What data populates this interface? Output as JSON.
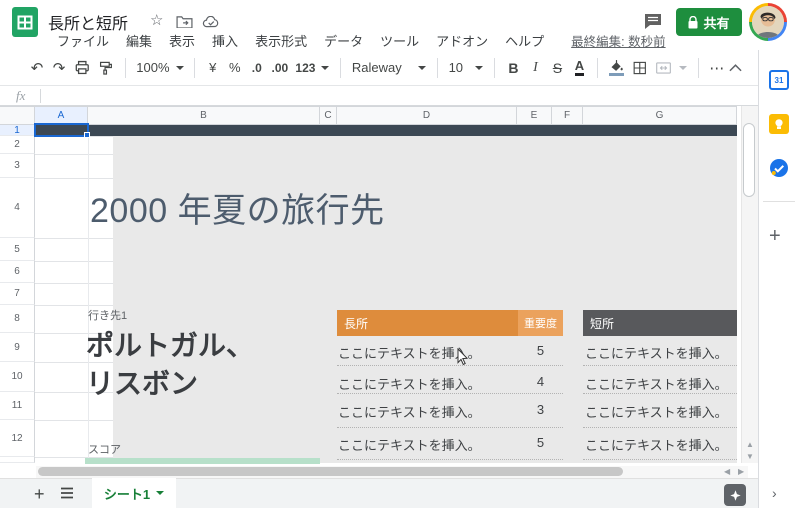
{
  "header": {
    "doc_title": "長所と短所",
    "menus": [
      "ファイル",
      "編集",
      "表示",
      "挿入",
      "表示形式",
      "データ",
      "ツール",
      "アドオン",
      "ヘルプ"
    ],
    "last_edit": "最終編集: 数秒前",
    "share_label": "共有"
  },
  "toolbar": {
    "zoom": "100%",
    "currency": "¥",
    "percent": "%",
    "decrease_decimal": ".0",
    "increase_decimal": ".00",
    "number_format": "123",
    "font_name": "Raleway",
    "font_size": "10",
    "bold": "B",
    "italic": "I",
    "strikethrough": "S",
    "text_color": "A",
    "more": "⋯"
  },
  "formula_bar": {
    "fx_label": "fx",
    "value": ""
  },
  "grid": {
    "columns": [
      "A",
      "B",
      "C",
      "D",
      "E",
      "F",
      "G"
    ],
    "rows": [
      "1",
      "2",
      "3",
      "4",
      "5",
      "6",
      "7",
      "8",
      "9",
      "10",
      "11",
      "12"
    ],
    "selected_cell": "A1"
  },
  "slide": {
    "title": "2000 年夏の旅行先",
    "destination_label": "行き先1",
    "destination_name_line1": "ポルトガル、",
    "destination_name_line2": "リスボン",
    "score_label": "スコア",
    "table": {
      "pros_header": "長所",
      "weight_header": "重要度",
      "cons_header": "短所",
      "rows": [
        {
          "pro": "ここにテキストを挿入。",
          "weight": "5",
          "con": "ここにテキストを挿入。"
        },
        {
          "pro": "ここにテキストを挿入。",
          "weight": "4",
          "con": "ここにテキストを挿入。"
        },
        {
          "pro": "ここにテキストを挿入。",
          "weight": "3",
          "con": "ここにテキストを挿入。"
        },
        {
          "pro": "ここにテキストを挿入。",
          "weight": "5",
          "con": "ここにテキストを挿入。"
        }
      ]
    }
  },
  "tabbar": {
    "active_sheet": "シート1"
  },
  "side_panel": {
    "calendar_label": "31"
  },
  "colors": {
    "accent_green": "#1e8e3e",
    "tab_green": "#188038",
    "selection_blue": "#1a73e8",
    "slide_bg": "#e9e9e9",
    "band_dark": "#3c4854",
    "pros_orange": "#de8c3c",
    "weight_orange": "#eba25d",
    "cons_gray": "#58595c",
    "score_bar_green": "#b7e0ca",
    "title_slate": "#4d5c6d"
  }
}
